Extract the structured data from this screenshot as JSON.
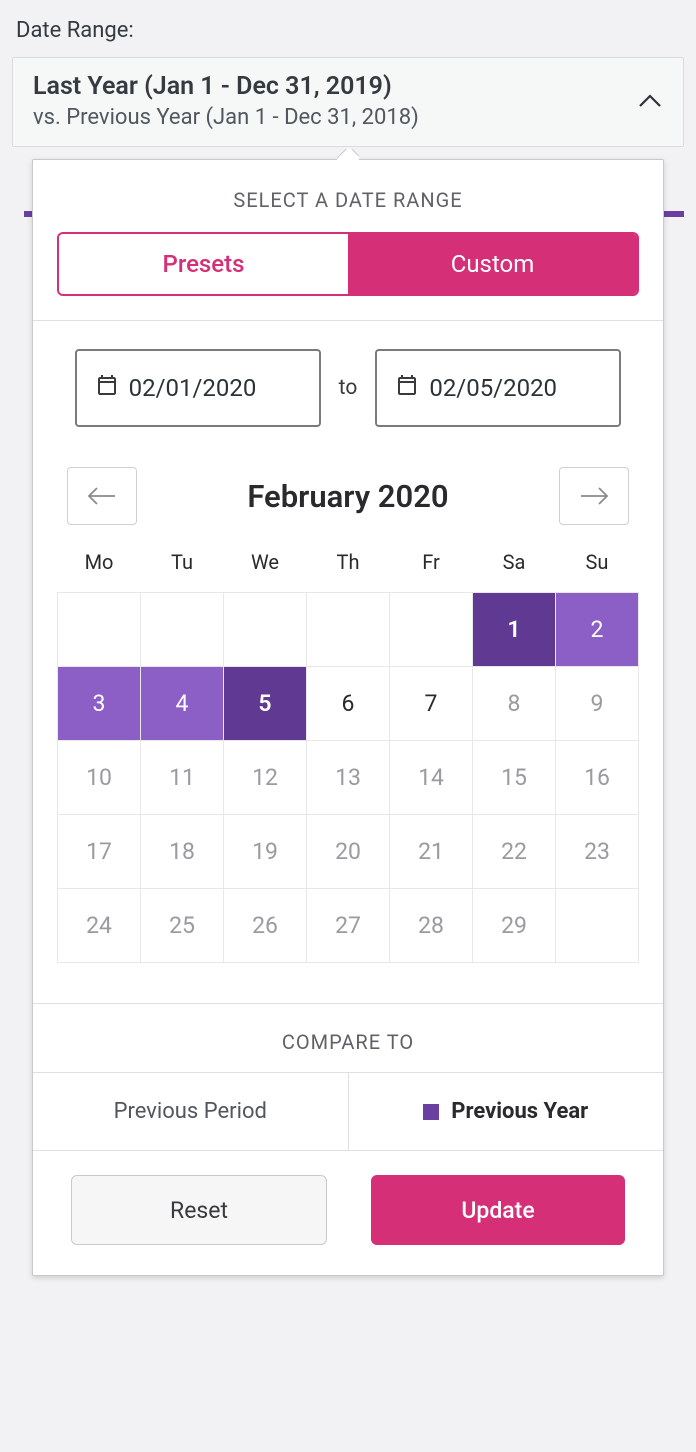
{
  "label_top": "Date Range:",
  "header": {
    "line1": "Last Year (Jan 1 - Dec 31, 2019)",
    "line2": "vs. Previous Year (Jan 1 - Dec 31, 2018)"
  },
  "dropdown": {
    "title": "SELECT A DATE RANGE",
    "tabs": {
      "presets": "Presets",
      "custom": "Custom"
    },
    "date_start": "02/01/2020",
    "date_separator": "to",
    "date_end": "02/05/2020",
    "month_label": "February 2020",
    "weekdays": [
      "Mo",
      "Tu",
      "We",
      "Th",
      "Fr",
      "Sa",
      "Su"
    ],
    "compare_title": "COMPARE TO",
    "compare": {
      "previous_period": "Previous Period",
      "previous_year": "Previous Year"
    },
    "actions": {
      "reset": "Reset",
      "update": "Update"
    }
  },
  "calendar": {
    "rows": [
      [
        {
          "d": "",
          "s": "empty"
        },
        {
          "d": "",
          "s": "empty"
        },
        {
          "d": "",
          "s": "empty"
        },
        {
          "d": "",
          "s": "empty"
        },
        {
          "d": "",
          "s": "empty"
        },
        {
          "d": "1",
          "s": "edge"
        },
        {
          "d": "2",
          "s": "range"
        }
      ],
      [
        {
          "d": "3",
          "s": "range"
        },
        {
          "d": "4",
          "s": "range"
        },
        {
          "d": "5",
          "s": "edge"
        },
        {
          "d": "6",
          "s": "current"
        },
        {
          "d": "7",
          "s": "current"
        },
        {
          "d": "8",
          "s": "future"
        },
        {
          "d": "9",
          "s": "future"
        }
      ],
      [
        {
          "d": "10",
          "s": "future"
        },
        {
          "d": "11",
          "s": "future"
        },
        {
          "d": "12",
          "s": "future"
        },
        {
          "d": "13",
          "s": "future"
        },
        {
          "d": "14",
          "s": "future"
        },
        {
          "d": "15",
          "s": "future"
        },
        {
          "d": "16",
          "s": "future"
        }
      ],
      [
        {
          "d": "17",
          "s": "future"
        },
        {
          "d": "18",
          "s": "future"
        },
        {
          "d": "19",
          "s": "future"
        },
        {
          "d": "20",
          "s": "future"
        },
        {
          "d": "21",
          "s": "future"
        },
        {
          "d": "22",
          "s": "future"
        },
        {
          "d": "23",
          "s": "future"
        }
      ],
      [
        {
          "d": "24",
          "s": "future"
        },
        {
          "d": "25",
          "s": "future"
        },
        {
          "d": "26",
          "s": "future"
        },
        {
          "d": "27",
          "s": "future"
        },
        {
          "d": "28",
          "s": "future"
        },
        {
          "d": "29",
          "s": "future"
        },
        {
          "d": "",
          "s": "empty"
        }
      ]
    ]
  },
  "colors": {
    "accent_pink": "#d42f77",
    "accent_purple_dark": "#5f3992",
    "accent_purple_light": "#8c5fc6"
  }
}
